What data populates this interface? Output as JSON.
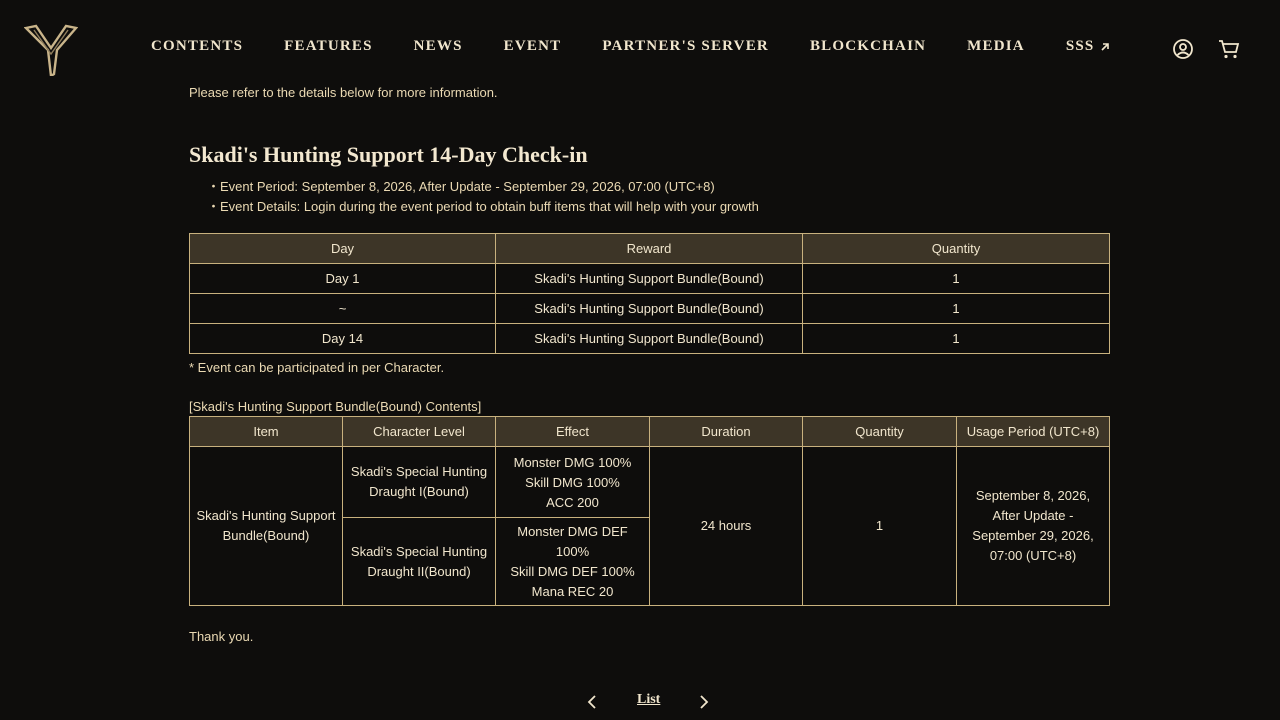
{
  "nav": {
    "items": [
      {
        "label": "CONTENTS"
      },
      {
        "label": "FEATURES"
      },
      {
        "label": "NEWS"
      },
      {
        "label": "EVENT"
      },
      {
        "label": "PARTNER'S SERVER"
      },
      {
        "label": "BLOCKCHAIN"
      },
      {
        "label": "MEDIA"
      },
      {
        "label": "SSS"
      }
    ]
  },
  "icons": {
    "logo": "y-emblem-logo",
    "account": "user-circle-icon",
    "cart": "cart-icon",
    "external": "arrow-up-right-icon"
  },
  "colors": {
    "background": "#0e0d0c",
    "text": "#ead9b3",
    "border": "#c8b17e",
    "header_row": "#3d3527"
  },
  "article": {
    "intro": "Please refer to the details below for more information.",
    "title": "Skadi's Hunting Support 14-Day Check-in",
    "bullets": [
      "・Event Period: September 8, 2026, After Update - September 29, 2026, 07:00 (UTC+8)",
      "・Event Details: Login during the event period to obtain buff items that will help with your growth"
    ],
    "checkin_table": {
      "headers": [
        "Day",
        "Reward",
        "Quantity"
      ],
      "rows": [
        [
          "Day 1",
          "Skadi's Hunting Support Bundle(Bound)",
          "1"
        ],
        [
          "~",
          "Skadi's Hunting Support Bundle(Bound)",
          "1"
        ],
        [
          "Day 14",
          "Skadi's Hunting Support Bundle(Bound)",
          "1"
        ]
      ]
    },
    "note": "* Event can be participated in per Character.",
    "bundle_heading": "[Skadi's Hunting Support Bundle(Bound) Contents]",
    "bundle_table": {
      "headers": [
        "Item",
        "Character Level",
        "Effect",
        "Duration",
        "Quantity",
        "Usage Period (UTC+8)"
      ],
      "item": "Skadi's Hunting Support Bundle(Bound)",
      "levels": [
        "Skadi's Special Hunting Draught I(Bound)",
        "Skadi's Special Hunting Draught II(Bound)"
      ],
      "effects": [
        [
          "Monster DMG 100%",
          "Skill DMG 100%",
          "ACC 200"
        ],
        [
          "Monster DMG DEF 100%",
          "Skill DMG DEF 100%",
          "Mana REC 20"
        ]
      ],
      "duration": "24 hours",
      "quantity": "1",
      "usage_period": "September 8, 2026, After Update - September 29, 2026, 07:00 (UTC+8)"
    },
    "closing": "Thank you."
  },
  "pager": {
    "list_label": "List"
  }
}
